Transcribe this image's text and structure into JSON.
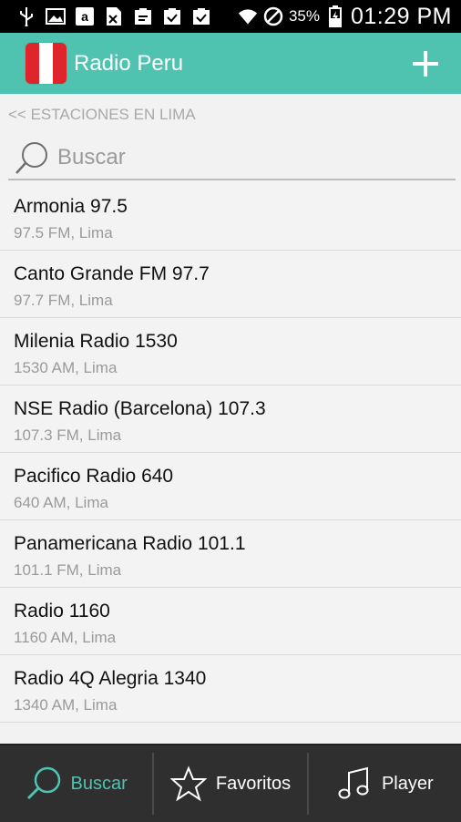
{
  "status_bar": {
    "battery_pct": "35%",
    "time": "01:29 PM"
  },
  "app": {
    "title": "Radio Peru",
    "flag_colors": [
      "#e0242b",
      "#ffffff",
      "#e0242b"
    ],
    "accent": "#4fc2b0"
  },
  "breadcrumb": "<< ESTACIONES EN LIMA",
  "search": {
    "placeholder": "Buscar"
  },
  "stations": [
    {
      "name": "Armonia 97.5",
      "sub": "97.5 FM, Lima"
    },
    {
      "name": "Canto Grande FM 97.7",
      "sub": "97.7 FM, Lima"
    },
    {
      "name": "Milenia Radio 1530",
      "sub": "1530 AM, Lima"
    },
    {
      "name": "NSE Radio (Barcelona) 107.3",
      "sub": "107.3 FM, Lima"
    },
    {
      "name": "Pacifico Radio 640",
      "sub": "640 AM, Lima"
    },
    {
      "name": "Panamericana Radio 101.1",
      "sub": "101.1 FM, Lima"
    },
    {
      "name": "Radio 1160",
      "sub": "1160 AM, Lima"
    },
    {
      "name": "Radio 4Q Alegria 1340",
      "sub": "1340 AM, Lima"
    }
  ],
  "bottom_nav": {
    "buscar": "Buscar",
    "favoritos": "Favoritos",
    "player": "Player"
  }
}
